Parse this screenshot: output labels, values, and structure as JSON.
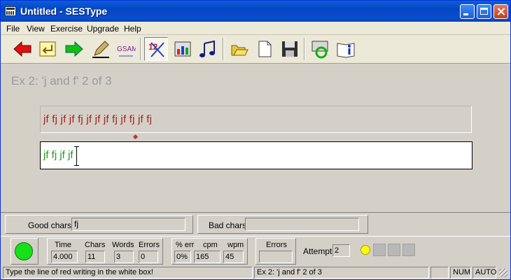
{
  "window": {
    "title": "Untitled - SESType"
  },
  "menu": [
    "File",
    "View",
    "Exercise",
    "Upgrade",
    "Help"
  ],
  "toolbar": {
    "icons": [
      "back-arrow-icon",
      "return-icon",
      "forward-arrow-icon",
      "pen-icon",
      "letters-icon",
      "numbers-icon",
      "bar-chart-icon",
      "music-notes-icon",
      "open-folder-icon",
      "new-document-icon",
      "save-disk-icon",
      "online-icon",
      "info-book-icon"
    ],
    "letters_label": "GSAM",
    "numbers_label": "12"
  },
  "exercise": {
    "title": "Ex 2: 'j and f' 2 of 3",
    "target_line": "jf fj jf jf fj jf jf jf fj jf fj jf fj",
    "typed_line": "jf fj jf jf"
  },
  "chars": {
    "good_label": "Good chars",
    "good_value": "fj",
    "bad_label": "Bad chars",
    "bad_value": ""
  },
  "stats": {
    "time_label": "Time",
    "time_value": "4.000",
    "chars_label": "Chars",
    "chars_value": "11",
    "words_label": "Words",
    "words_value": "3",
    "errors_label": "Errors",
    "errors_value": "0",
    "err_pct_label": "% err",
    "err_pct_value": "0%",
    "cpm_label": "cpm",
    "cpm_value": "165",
    "wpm_label": "wpm",
    "wpm_value": "45",
    "errors2_label": "Errors",
    "errors2_value": "",
    "attempt_label": "Attempt",
    "attempt_value": "2"
  },
  "statusbar": {
    "hint": "Type the line of red writing in the white box!",
    "exercise": "Ex 2: 'j and f' 2 of 3",
    "cell3": "",
    "num": "NUM",
    "auto": "AUTO"
  },
  "colors": {
    "target_text": "#a52020",
    "typed_text": "#1e9a1e",
    "status_ok": "#18e018"
  }
}
